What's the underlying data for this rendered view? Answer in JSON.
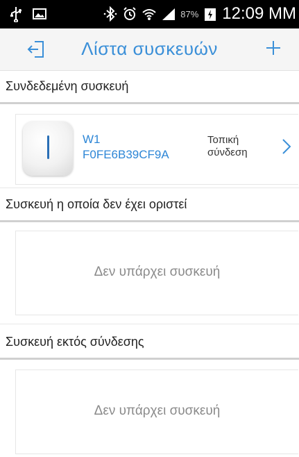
{
  "status_bar": {
    "battery": "87%",
    "time": "12:09 MM"
  },
  "header": {
    "title": "Λίστα συσκευών"
  },
  "sections": {
    "connected_title": "Συνδεδεμένη συσκευή",
    "unassigned_title": "Συσκευή η οποία δεν έχει οριστεί",
    "offline_title": "Συσκευή εκτός σύνδεσης"
  },
  "device": {
    "name": "W1",
    "mac": "F0FE6B39CF9A",
    "status_line1": "Τοπική",
    "status_line2": "σύνδεση"
  },
  "empty_unassigned": "Δεν υπάρχει συσκευή",
  "empty_offline": "Δεν υπάρχει συσκευή",
  "colors": {
    "accent": "#3a8fd8",
    "statusbar": "#000000",
    "header_bg": "#f5f5f5"
  }
}
